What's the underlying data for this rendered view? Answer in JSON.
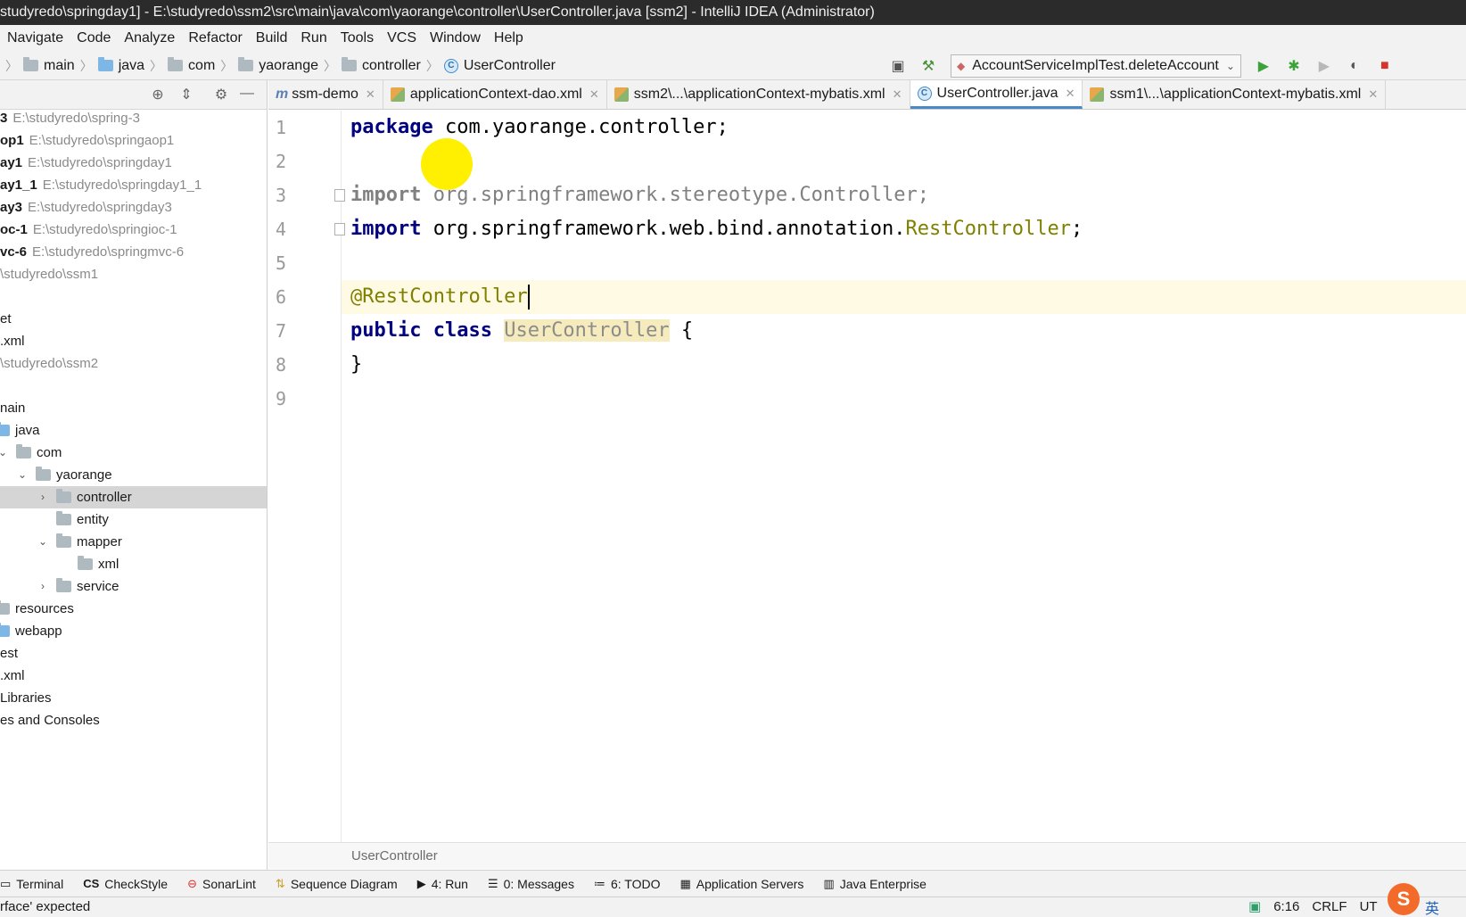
{
  "window": {
    "title": "studyredo\\springday1] - E:\\studyredo\\ssm2\\src\\main\\java\\com\\yaorange\\controller\\UserController.java [ssm2] - IntelliJ IDEA (Administrator)"
  },
  "menu": [
    "Navigate",
    "Code",
    "Analyze",
    "Refactor",
    "Build",
    "Run",
    "Tools",
    "VCS",
    "Window",
    "Help"
  ],
  "breadcrumb": {
    "items": [
      "main",
      "java",
      "com",
      "yaorange",
      "controller",
      "UserController"
    ]
  },
  "run_config": {
    "label": "AccountServiceImplTest.deleteAccount"
  },
  "project_tree": {
    "rows": [
      {
        "name": "3",
        "path": "E:\\studyredo\\spring-3"
      },
      {
        "name": "op1",
        "path": "E:\\studyredo\\springaop1"
      },
      {
        "name": "ay1",
        "path": "E:\\studyredo\\springday1"
      },
      {
        "name": "ay1_1",
        "path": "E:\\studyredo\\springday1_1"
      },
      {
        "name": "ay3",
        "path": "E:\\studyredo\\springday3"
      },
      {
        "name": "oc-1",
        "path": "E:\\studyredo\\springioc-1"
      },
      {
        "name": "vc-6",
        "path": "E:\\studyredo\\springmvc-6"
      },
      {
        "name": "\\studyredo\\ssm1"
      },
      {
        "name": "et"
      },
      {
        "name": ".xml"
      },
      {
        "name": "\\studyredo\\ssm2"
      },
      {
        "name": "nain"
      },
      {
        "name": "java"
      },
      {
        "name": "com"
      },
      {
        "name": "yaorange"
      },
      {
        "name": "controller"
      },
      {
        "name": "entity"
      },
      {
        "name": "mapper"
      },
      {
        "name": "xml"
      },
      {
        "name": "service"
      },
      {
        "name": "resources"
      },
      {
        "name": "webapp"
      },
      {
        "name": "est"
      },
      {
        "name": ".xml"
      },
      {
        "name": "Libraries"
      },
      {
        "name": "es and Consoles"
      }
    ]
  },
  "tabs": [
    {
      "label": "ssm-demo"
    },
    {
      "label": "applicationContext-dao.xml"
    },
    {
      "label": "ssm2\\...\\applicationContext-mybatis.xml"
    },
    {
      "label": "UserController.java"
    },
    {
      "label": "ssm1\\...\\applicationContext-mybatis.xml"
    }
  ],
  "editor": {
    "line_numbers": [
      "1",
      "2",
      "3",
      "4",
      "5",
      "6",
      "7",
      "8",
      "9"
    ],
    "code": {
      "l1_kw": "package",
      "l1_rest": " com.yaorange.controller;",
      "l3_kw": "import",
      "l3_rest": " org.springframework.stereotype.Controller;",
      "l4_kw": "import",
      "l4_rest": " org.springframework.web.bind.annotation.",
      "l4_cls": "RestController",
      "l4_end": ";",
      "l6_ann": "@RestController",
      "l7_kw": "public class",
      "l7_cls": "UserController",
      "l7_end": " {",
      "l8": "}"
    },
    "breadcrumb": "UserController"
  },
  "tool_windows": [
    {
      "label": "Terminal",
      "icon": "terminal-icon"
    },
    {
      "label": "CheckStyle",
      "icon": "checkstyle-icon"
    },
    {
      "label": "SonarLint",
      "icon": "sonarlint-icon"
    },
    {
      "label": "Sequence Diagram",
      "icon": "sequence-diagram-icon"
    },
    {
      "label": "4: Run",
      "icon": "run-icon"
    },
    {
      "label": "0: Messages",
      "icon": "messages-icon"
    },
    {
      "label": "6: TODO",
      "icon": "todo-icon"
    },
    {
      "label": "Application Servers",
      "icon": "servers-icon"
    },
    {
      "label": "Java Enterprise",
      "icon": "java-enterprise-icon"
    }
  ],
  "status": {
    "message": "rface' expected",
    "position": "6:16",
    "line_sep": "CRLF",
    "encoding": "UT",
    "ime": "英"
  }
}
